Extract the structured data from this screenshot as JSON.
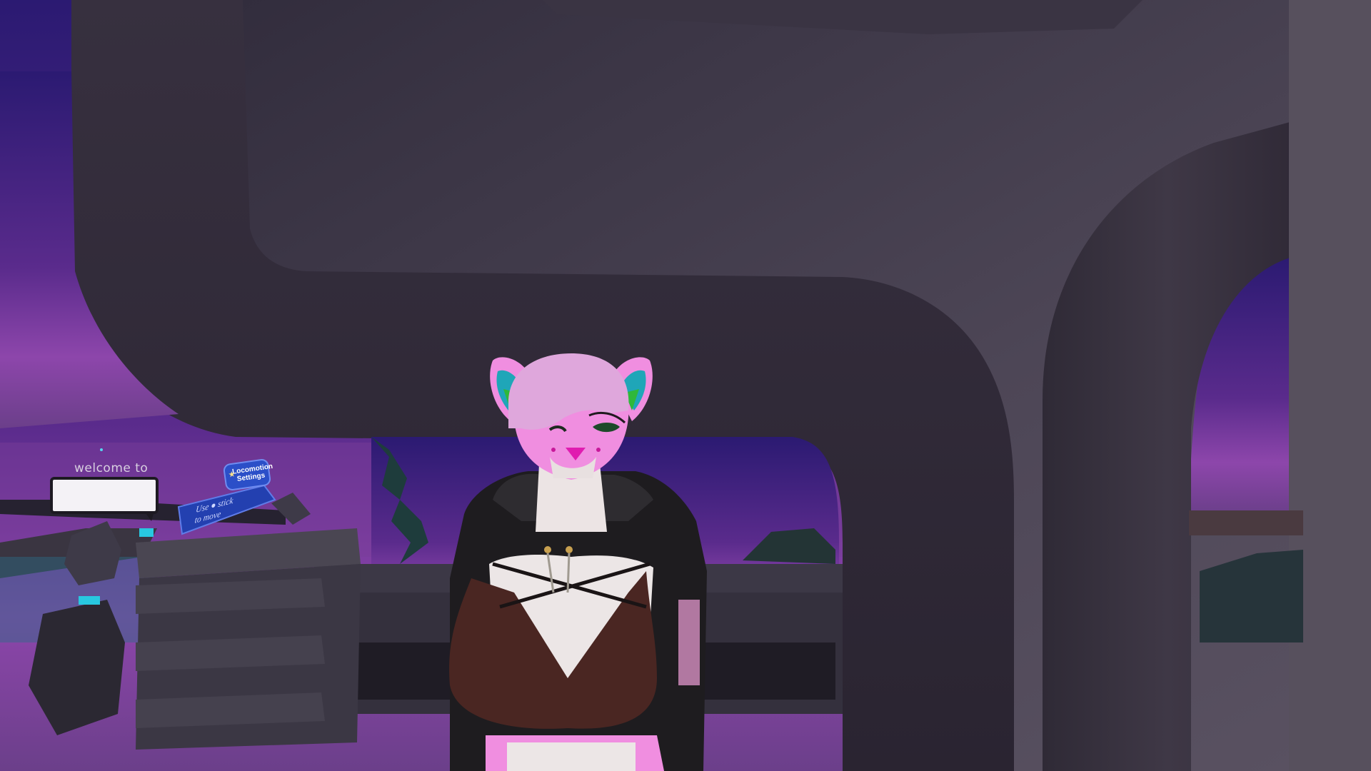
{
  "world": {
    "sign_caption": "welcome to",
    "sign_text": "",
    "locomotion_button": {
      "line1": "Locomotion",
      "line2": "Settings",
      "icon": "walking-figure-icon"
    },
    "hint_panel": {
      "line1": "Use ● stick",
      "line2": "to move"
    }
  },
  "colors": {
    "sky_top": "#2a1b6e",
    "sky_bottom": "#8a3fa8",
    "stone": "#4a4352",
    "avatar_fur": "#f08ee0",
    "avatar_hair": "#dfa7dc",
    "ear_inner_teal": "#1fa6b8",
    "ear_inner_green": "#2fb83a",
    "hoodie": "#1e1c1f",
    "top_fabric": "#4a2622",
    "ui_blue": "#2b4fc8"
  }
}
